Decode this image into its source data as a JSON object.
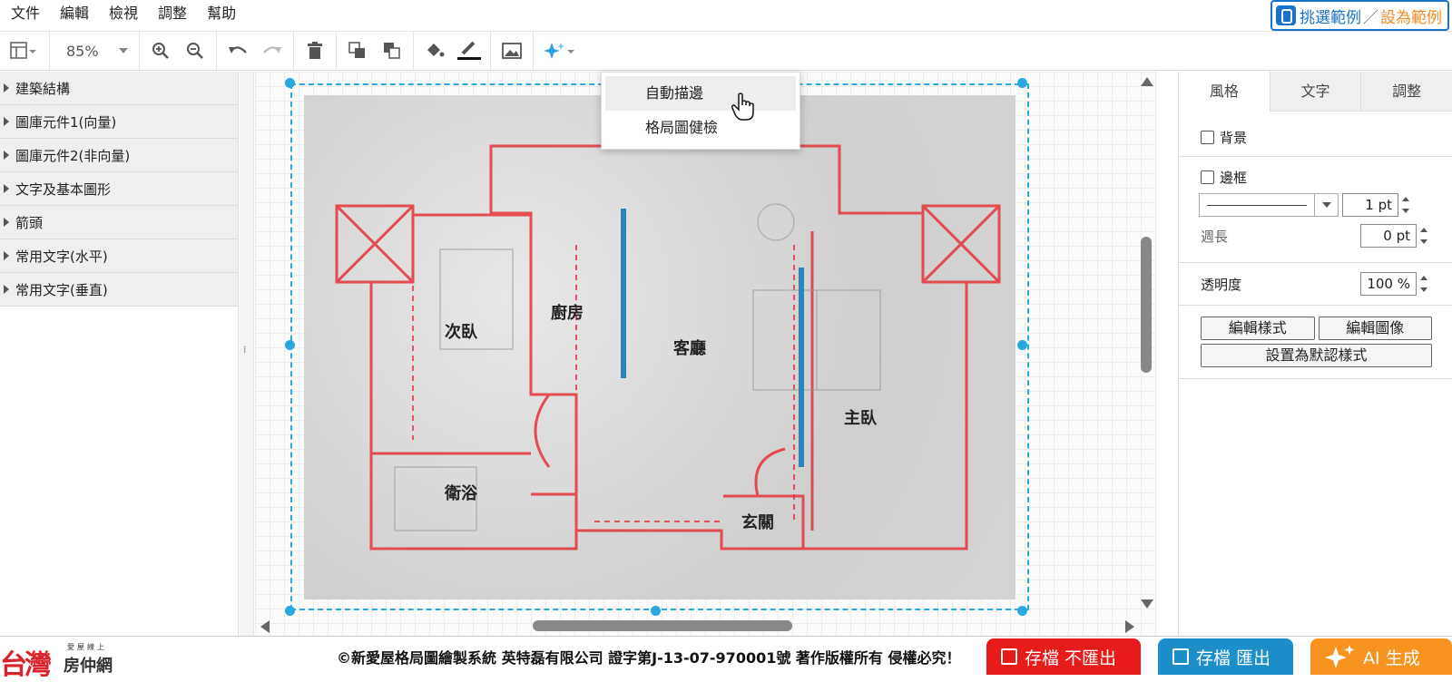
{
  "menubar": {
    "items": [
      "文件",
      "編輯",
      "檢視",
      "調整",
      "幫助"
    ],
    "example_pick": "挑選範例",
    "example_sep": "／",
    "example_setas": "設為範例"
  },
  "toolbar": {
    "zoom": "85%"
  },
  "sidebar": {
    "items": [
      "建築結構",
      "圖庫元件1(向量)",
      "圖庫元件2(非向量)",
      "文字及基本圖形",
      "箭頭",
      "常用文字(水平)",
      "常用文字(垂直)"
    ]
  },
  "splitter": {
    "grip": "⁞"
  },
  "floorplan": {
    "rooms": [
      "次臥",
      "廚房",
      "客廳",
      "主臥",
      "衛浴",
      "玄關"
    ]
  },
  "ai_menu": {
    "items": [
      "自動描邊",
      "格局圖健檢"
    ]
  },
  "right_panel": {
    "tabs": [
      "風格",
      "文字",
      "調整"
    ],
    "background_label": "背景",
    "border_label": "邊框",
    "border_width": "1 pt",
    "perimeter_label": "週長",
    "perimeter_value": "0 pt",
    "opacity_label": "透明度",
    "opacity_value": "100 %",
    "edit_style": "編輯樣式",
    "edit_image": "編輯圖像",
    "set_default": "設置為默認樣式"
  },
  "footer": {
    "logo_big": "台灣",
    "logo_small": "愛屋線上",
    "logo_name": "房仲網",
    "copyright": "©新愛屋格局圖繪製系統 英特磊有限公司 證字第J-13-07-970001號 著作版權所有 侵權必究！",
    "save_noexport": "存檔 不匯出",
    "save_export": "存檔 匯出",
    "ai_generate": "AI 生成"
  },
  "colors": {
    "accent": "#29a8e0",
    "save_red": "#e81b1b",
    "save_blue": "#1c8fca",
    "ai_orange": "#f7931e"
  }
}
